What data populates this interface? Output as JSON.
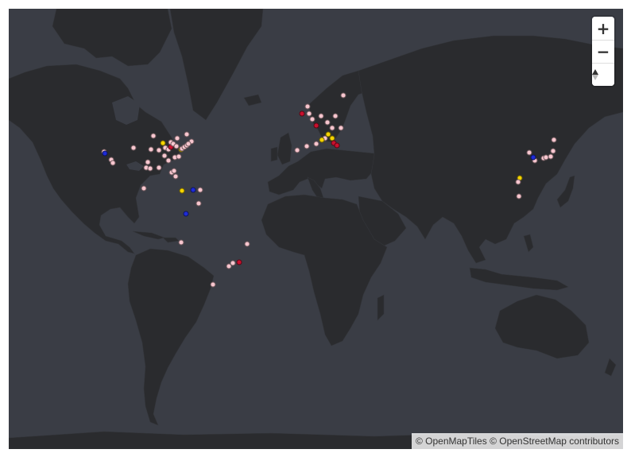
{
  "controls": {
    "zoom_in": "+",
    "zoom_out": "−",
    "compass_icon": "compass-icon"
  },
  "attribution": "© OpenMapTiles © OpenStreetMap contributors",
  "colors": {
    "water": "#3a3d45",
    "land": "#2a2b2e",
    "pink": "#f7c6cf",
    "red": "#c8102e",
    "yellow": "#f5d400",
    "blue": "#1e2bd6"
  },
  "markers": [
    {
      "lon": -122.4,
      "lat": 37.8,
      "color": "pink"
    },
    {
      "lon": -121.9,
      "lat": 37.3,
      "color": "blue"
    },
    {
      "lon": -118.2,
      "lat": 34.1,
      "color": "pink"
    },
    {
      "lon": -117.2,
      "lat": 32.7,
      "color": "pink"
    },
    {
      "lon": -104.9,
      "lat": 39.7,
      "color": "pink"
    },
    {
      "lon": -97.7,
      "lat": 30.3,
      "color": "pink"
    },
    {
      "lon": -96.8,
      "lat": 32.8,
      "color": "pink"
    },
    {
      "lon": -95.4,
      "lat": 29.8,
      "color": "pink"
    },
    {
      "lon": -94.6,
      "lat": 39.1,
      "color": "pink"
    },
    {
      "lon": -93.3,
      "lat": 44.9,
      "color": "pink"
    },
    {
      "lon": -90.2,
      "lat": 38.6,
      "color": "pink"
    },
    {
      "lon": -90.1,
      "lat": 30.0,
      "color": "pink"
    },
    {
      "lon": -87.6,
      "lat": 41.9,
      "color": "yellow"
    },
    {
      "lon": -86.8,
      "lat": 36.2,
      "color": "pink"
    },
    {
      "lon": -86.2,
      "lat": 39.8,
      "color": "pink"
    },
    {
      "lon": -84.4,
      "lat": 33.7,
      "color": "pink"
    },
    {
      "lon": -84.5,
      "lat": 39.1,
      "color": "pink"
    },
    {
      "lon": -83.0,
      "lat": 40.0,
      "color": "red"
    },
    {
      "lon": -83.0,
      "lat": 42.3,
      "color": "pink"
    },
    {
      "lon": -81.7,
      "lat": 41.5,
      "color": "pink"
    },
    {
      "lon": -80.8,
      "lat": 35.2,
      "color": "pink"
    },
    {
      "lon": -80.2,
      "lat": 25.8,
      "color": "pink"
    },
    {
      "lon": -82.5,
      "lat": 27.9,
      "color": "pink"
    },
    {
      "lon": -81.4,
      "lat": 28.5,
      "color": "pink"
    },
    {
      "lon": -80.0,
      "lat": 40.4,
      "color": "pink"
    },
    {
      "lon": -79.4,
      "lat": 43.7,
      "color": "pink"
    },
    {
      "lon": -77.0,
      "lat": 38.9,
      "color": "yellow"
    },
    {
      "lon": -76.6,
      "lat": 39.3,
      "color": "pink"
    },
    {
      "lon": -75.2,
      "lat": 40.0,
      "color": "pink"
    },
    {
      "lon": -74.0,
      "lat": 40.7,
      "color": "pink"
    },
    {
      "lon": -73.6,
      "lat": 45.5,
      "color": "pink"
    },
    {
      "lon": -71.1,
      "lat": 42.4,
      "color": "pink"
    },
    {
      "lon": -72.9,
      "lat": 41.3,
      "color": "pink"
    },
    {
      "lon": -78.6,
      "lat": 35.8,
      "color": "pink"
    },
    {
      "lon": -99.1,
      "lat": 19.4,
      "color": "pink"
    },
    {
      "lon": -76.8,
      "lat": 18.0,
      "color": "yellow"
    },
    {
      "lon": -69.9,
      "lat": 18.5,
      "color": "blue"
    },
    {
      "lon": -66.1,
      "lat": 18.4,
      "color": "pink"
    },
    {
      "lon": -74.1,
      "lat": 4.7,
      "color": "blue"
    },
    {
      "lon": -66.9,
      "lat": 10.5,
      "color": "pink"
    },
    {
      "lon": -77.0,
      "lat": -12.0,
      "color": "pink"
    },
    {
      "lon": -38.5,
      "lat": -12.9,
      "color": "pink"
    },
    {
      "lon": -43.2,
      "lat": -22.9,
      "color": "red"
    },
    {
      "lon": -46.6,
      "lat": -23.5,
      "color": "pink"
    },
    {
      "lon": -49.3,
      "lat": -25.4,
      "color": "pink"
    },
    {
      "lon": -58.4,
      "lat": -34.6,
      "color": "pink"
    },
    {
      "lon": -0.1,
      "lat": 51.5,
      "color": "pink"
    },
    {
      "lon": -2.2,
      "lat": 53.5,
      "color": "pink"
    },
    {
      "lon": -3.2,
      "lat": 55.9,
      "color": "pink"
    },
    {
      "lon": -6.3,
      "lat": 53.3,
      "color": "red"
    },
    {
      "lon": 2.3,
      "lat": 48.9,
      "color": "red"
    },
    {
      "lon": 4.9,
      "lat": 52.4,
      "color": "pink"
    },
    {
      "lon": -3.7,
      "lat": 40.4,
      "color": "pink"
    },
    {
      "lon": -9.1,
      "lat": 38.7,
      "color": "pink"
    },
    {
      "lon": 2.2,
      "lat": 41.4,
      "color": "pink"
    },
    {
      "lon": 7.3,
      "lat": 43.7,
      "color": "pink"
    },
    {
      "lon": 5.4,
      "lat": 43.3,
      "color": "yellow"
    },
    {
      "lon": 9.2,
      "lat": 45.5,
      "color": "yellow"
    },
    {
      "lon": 11.3,
      "lat": 43.8,
      "color": "yellow"
    },
    {
      "lon": 12.5,
      "lat": 41.9,
      "color": "red"
    },
    {
      "lon": 14.3,
      "lat": 40.9,
      "color": "red"
    },
    {
      "lon": 13.4,
      "lat": 52.5,
      "color": "pink"
    },
    {
      "lon": 8.7,
      "lat": 50.1,
      "color": "pink"
    },
    {
      "lon": 16.4,
      "lat": 48.2,
      "color": "pink"
    },
    {
      "lon": 18.1,
      "lat": 59.3,
      "color": "pink"
    },
    {
      "lon": 11.6,
      "lat": 48.1,
      "color": "pink"
    },
    {
      "lon": 139.7,
      "lat": 35.7,
      "color": "pink"
    },
    {
      "lon": 135.5,
      "lat": 34.7,
      "color": "pink"
    },
    {
      "lon": 136.9,
      "lat": 35.2,
      "color": "pink"
    },
    {
      "lon": 130.4,
      "lat": 33.6,
      "color": "pink"
    },
    {
      "lon": 141.3,
      "lat": 43.1,
      "color": "pink"
    },
    {
      "lon": 140.9,
      "lat": 38.3,
      "color": "pink"
    },
    {
      "lon": 126.98,
      "lat": 37.57,
      "color": "pink"
    },
    {
      "lon": 129.1,
      "lat": 35.2,
      "color": "blue"
    },
    {
      "lon": 121.5,
      "lat": 25.0,
      "color": "yellow"
    },
    {
      "lon": 120.3,
      "lat": 22.6,
      "color": "pink"
    },
    {
      "lon": 121.0,
      "lat": 14.6,
      "color": "pink"
    }
  ]
}
